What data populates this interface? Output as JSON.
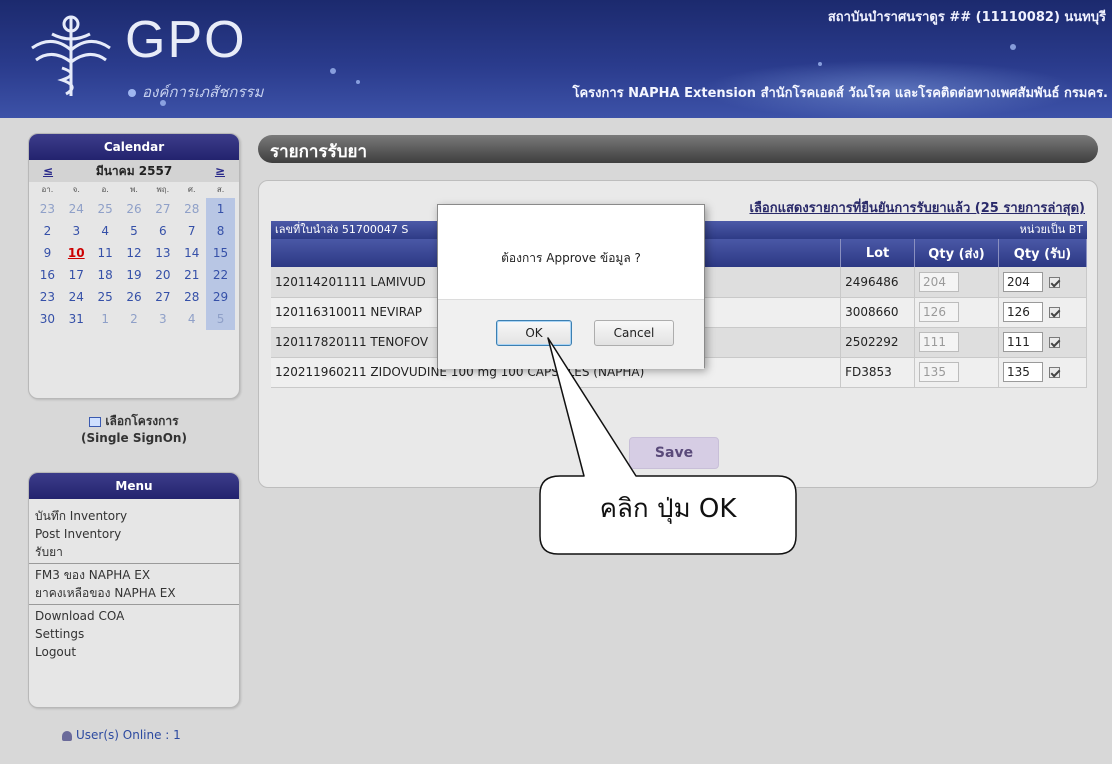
{
  "header": {
    "logo_text": "GPO",
    "logo_subtitle": "องค์การเภสัชกรรม",
    "site_name": "สถาบันบำราศนราดูร ## (11110082) นนทบุรี",
    "project_name": "โครงการ NAPHA Extension สำนักโรคเอดส์ วัณโรค และโรคติดต่อทางเพศสัมพันธ์ กรมคร."
  },
  "calendar": {
    "title": "Calendar",
    "prev": "≤",
    "next": "≥",
    "month": "มีนาคม 2557",
    "day_headers": [
      "อา.",
      "จ.",
      "อ.",
      "พ.",
      "พฤ.",
      "ศ.",
      "ส."
    ],
    "weeks": [
      [
        "23",
        "24",
        "25",
        "26",
        "27",
        "28",
        "1"
      ],
      [
        "2",
        "3",
        "4",
        "5",
        "6",
        "7",
        "8"
      ],
      [
        "9",
        "10",
        "11",
        "12",
        "13",
        "14",
        "15"
      ],
      [
        "16",
        "17",
        "18",
        "19",
        "20",
        "21",
        "22"
      ],
      [
        "23",
        "24",
        "25",
        "26",
        "27",
        "28",
        "29"
      ],
      [
        "30",
        "31",
        "1",
        "2",
        "3",
        "4",
        "5"
      ]
    ],
    "today": "10"
  },
  "project_link": {
    "label": "เลือกโครงการ",
    "sub": "(Single SignOn)"
  },
  "menu": {
    "title": "Menu",
    "groups": [
      [
        "บันทึก Inventory",
        "Post Inventory",
        "รับยา"
      ],
      [
        "FM3 ของ NAPHA EX",
        "ยาคงเหลือของ NAPHA EX"
      ],
      [
        "Download COA",
        "Settings",
        "Logout"
      ]
    ]
  },
  "online": "User(s) Online : 1",
  "page": {
    "title": "รายการรับยา",
    "recent_link": "เลือกแสดงรายการที่ยืนยันการรับยาแล้ว (25 รายการล่าสุด)",
    "doc_no": "เลขที่ใบนำส่ง 51700047   S",
    "unit_note": "หน่วยเป็น BT",
    "columns": [
      "",
      "Lot",
      "Qty (ส่ง)",
      "Qty (รับ)"
    ],
    "rows": [
      {
        "item": "120114201111 LAMIVUD",
        "lot": "2496486",
        "qty_sent": "204",
        "qty_recv": "204"
      },
      {
        "item": "120116310011 NEVIRAP",
        "lot": "3008660",
        "qty_sent": "126",
        "qty_recv": "126"
      },
      {
        "item": "120117820111 TENOFOV",
        "lot": "2502292",
        "qty_sent": "111",
        "qty_recv": "111"
      },
      {
        "item": "120211960211 ZIDOVUDINE 100 mg 100 CAPSULES (NAPHA)",
        "lot": "FD3853",
        "qty_sent": "135",
        "qty_recv": "135"
      }
    ],
    "save_label": "Save"
  },
  "dialog": {
    "message": "ต้องการ Approve ข้อมูล ?",
    "ok": "OK",
    "cancel": "Cancel"
  },
  "callout": {
    "text": "คลิก ปุ่ม OK"
  }
}
